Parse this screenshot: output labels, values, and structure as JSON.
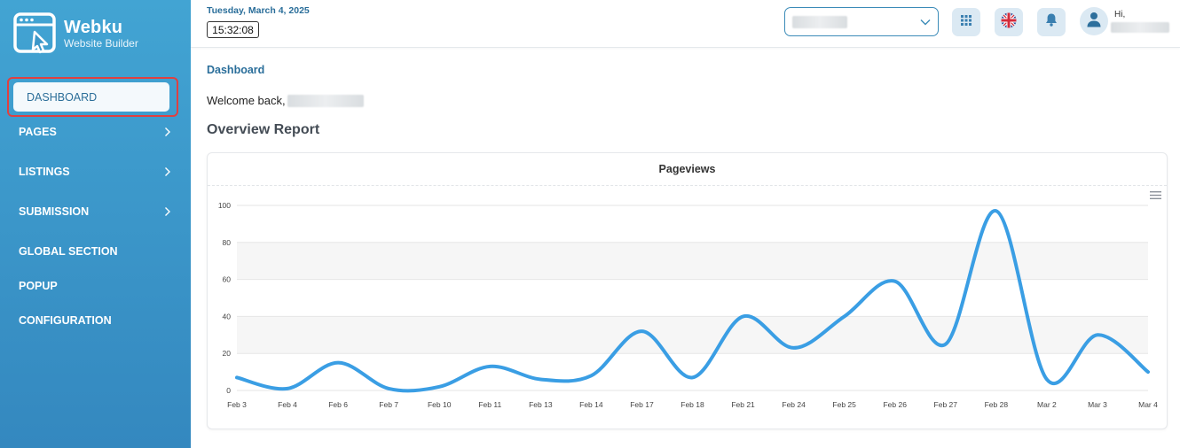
{
  "app": {
    "logo_title": "Webku",
    "logo_subtitle": "Website Builder"
  },
  "sidebar": {
    "items": [
      {
        "label": "DASHBOARD",
        "active": true,
        "has_chevron": false
      },
      {
        "label": "PAGES",
        "active": false,
        "has_chevron": true
      },
      {
        "label": "LISTINGS",
        "active": false,
        "has_chevron": true
      },
      {
        "label": "SUBMISSION",
        "active": false,
        "has_chevron": true
      },
      {
        "label": "GLOBAL SECTION",
        "active": false,
        "has_chevron": false
      },
      {
        "label": "POPUP",
        "active": false,
        "has_chevron": false
      },
      {
        "label": "CONFIGURATION",
        "active": false,
        "has_chevron": false
      }
    ]
  },
  "header": {
    "date": "Tuesday, March 4, 2025",
    "time": "15:32:08",
    "greeting": "Hi,",
    "icons": [
      "apps-grid-icon",
      "uk-flag-icon",
      "bell-icon",
      "user-avatar-icon"
    ]
  },
  "main": {
    "breadcrumb": "Dashboard",
    "welcome": "Welcome back,",
    "section_title": "Overview Report",
    "chart_title": "Pageviews"
  },
  "colors": {
    "sidebar_top": "#42a4d3",
    "sidebar_bottom": "#3488bf",
    "accent": "#2a6e9a",
    "line": "#3a9ee4"
  },
  "chart_data": {
    "type": "line",
    "title": "Pageviews",
    "xlabel": "",
    "ylabel": "",
    "categories": [
      "Feb 3",
      "Feb 4",
      "Feb 6",
      "Feb 7",
      "Feb 10",
      "Feb 11",
      "Feb 13",
      "Feb 14",
      "Feb 17",
      "Feb 18",
      "Feb 21",
      "Feb 24",
      "Feb 25",
      "Feb 26",
      "Feb 27",
      "Feb 28",
      "Mar 2",
      "Mar 3",
      "Mar 4"
    ],
    "series": [
      {
        "values": [
          7,
          1,
          15,
          1,
          2,
          13,
          6,
          8,
          32,
          7,
          40,
          23,
          40,
          59,
          25,
          97,
          6,
          30,
          10
        ]
      }
    ],
    "yticks": [
      0,
      20,
      40,
      60,
      80,
      100
    ],
    "ylim": [
      0,
      100
    ],
    "grid": true,
    "legend": "none"
  }
}
